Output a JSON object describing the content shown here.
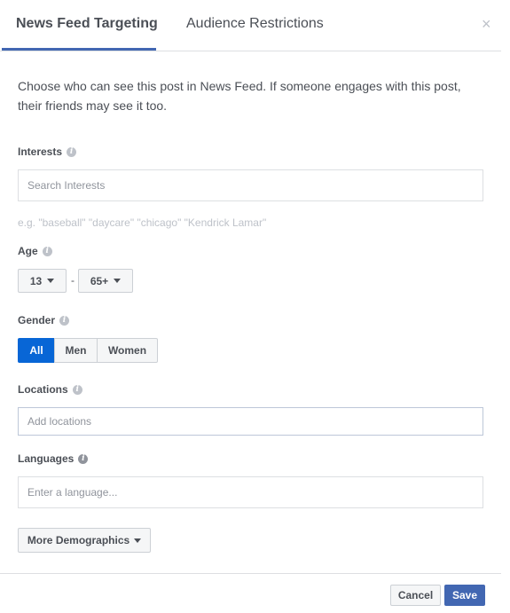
{
  "tabs": [
    {
      "label": "News Feed Targeting",
      "active": true
    },
    {
      "label": "Audience Restrictions",
      "active": false
    }
  ],
  "close_icon": "×",
  "description": "Choose who can see this post in News Feed. If someone engages with this post, their friends may see it too.",
  "interests": {
    "label": "Interests",
    "placeholder": "Search Interests",
    "hint": "e.g. \"baseball\" \"daycare\" \"chicago\" \"Kendrick Lamar\""
  },
  "age": {
    "label": "Age",
    "min": "13",
    "separator": "-",
    "max": "65+"
  },
  "gender": {
    "label": "Gender",
    "options": [
      "All",
      "Men",
      "Women"
    ],
    "selected": "All"
  },
  "locations": {
    "label": "Locations",
    "placeholder": "Add locations"
  },
  "languages": {
    "label": "Languages",
    "placeholder": "Enter a language..."
  },
  "more_demographics": "More Demographics",
  "footer": {
    "cancel": "Cancel",
    "save": "Save"
  },
  "colors": {
    "accent": "#4267b2",
    "selected": "#0866d6"
  },
  "info_icon": "i"
}
